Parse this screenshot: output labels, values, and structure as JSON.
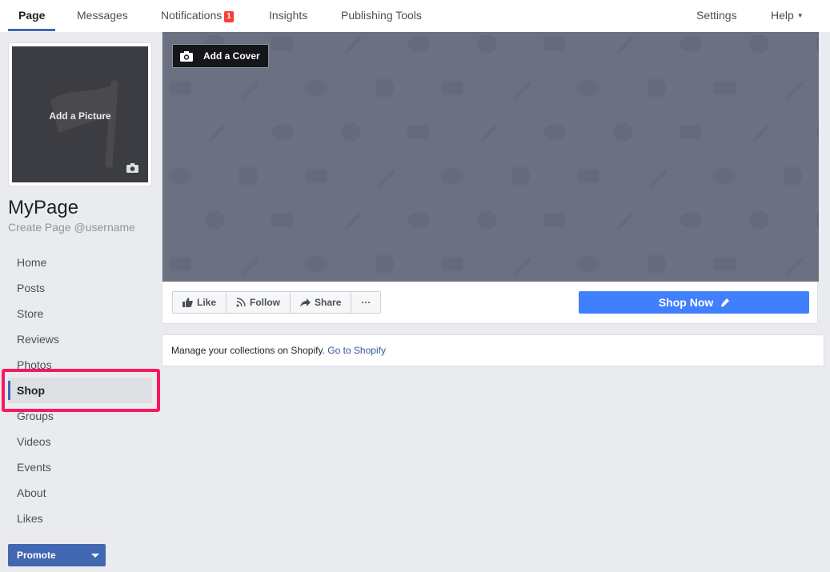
{
  "topnav": {
    "tabs": [
      {
        "label": "Page",
        "active": true
      },
      {
        "label": "Messages"
      },
      {
        "label": "Notifications",
        "badge": "1"
      },
      {
        "label": "Insights"
      },
      {
        "label": "Publishing Tools"
      }
    ],
    "right": [
      {
        "label": "Settings"
      },
      {
        "label": "Help",
        "has_caret": true
      }
    ],
    "accent_color": "#4267b2",
    "badge_color": "#fa3e3e"
  },
  "profile": {
    "picture_label": "Add a Picture",
    "name": "MyPage",
    "username_prompt": "Create Page @username"
  },
  "sidenav": {
    "items": [
      {
        "label": "Home"
      },
      {
        "label": "Posts"
      },
      {
        "label": "Store"
      },
      {
        "label": "Reviews"
      },
      {
        "label": "Photos"
      },
      {
        "label": "Shop",
        "active": true,
        "highlighted": true
      },
      {
        "label": "Groups"
      },
      {
        "label": "Videos"
      },
      {
        "label": "Events"
      },
      {
        "label": "About"
      },
      {
        "label": "Likes"
      }
    ],
    "highlight_color": "#f7195f"
  },
  "promote_button": {
    "label": "Promote"
  },
  "cover": {
    "add_cover_label": "Add a Cover"
  },
  "actions": {
    "like": "Like",
    "follow": "Follow",
    "share": "Share",
    "more": "···"
  },
  "shop_now": {
    "label": "Shop Now",
    "color": "#4080ff"
  },
  "manage": {
    "text": "Manage your collections on Shopify.",
    "link": "Go to Shopify"
  }
}
